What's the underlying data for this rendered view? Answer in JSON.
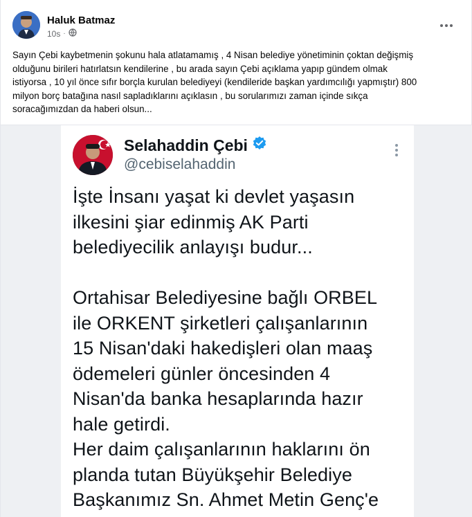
{
  "post": {
    "author": "Haluk Batmaz",
    "timestamp": "10s",
    "audience_icon": "globe-icon",
    "more_icon": "more-dots-icon",
    "text_lines": [
      "Sayın Çebi kaybetmenin  şokunu hala atlatamamış , 4 Nisan belediye yönetiminin çoktan değişmiş",
      "olduğunu birileri hatırlatsın kendilerine , bu arada sayın Çebi açıklama yapıp gündem olmak",
      "istiyorsa , 10 yıl önce sıfır borçla kurulan belediyeyi (kendileride başkan yardımcılığı yapmıştır) 800",
      "milyon borç batağına nasıl sapladıklarını açıklasın , bu sorularımızı zaman içinde sıkça",
      "soracağımızdan da haberi olsun..."
    ]
  },
  "tweet": {
    "name": "Selahaddin Çebi",
    "handle": "@cebiselahaddin",
    "verified_icon": "verified-badge-icon",
    "more_icon": "vertical-dots-icon",
    "paragraph1": [
      "İşte İnsanı yaşat ki devlet yaşasın",
      "ilkesini şiar edinmiş AK Parti",
      "belediyecilik anlayışı budur..."
    ],
    "paragraph2": [
      "Ortahisar Belediyesine bağlı ORBEL",
      "ile ORKENT şirketleri çalışanlarının",
      "15 Nisan'daki hakedişleri olan maaş",
      "ödemeleri günler öncesinden 4",
      "Nisan'da banka hesaplarında hazır",
      "hale getirdi.",
      "Her daim çalışanlarının haklarını ön",
      "planda tutan Büyükşehir Belediye",
      "Başkanımız Sn. Ahmet Metin Genç'e"
    ]
  },
  "colors": {
    "text_primary": "#050505",
    "text_secondary": "#65676b",
    "verified_blue": "#1d9bf0",
    "tweet_handle": "#536471"
  }
}
